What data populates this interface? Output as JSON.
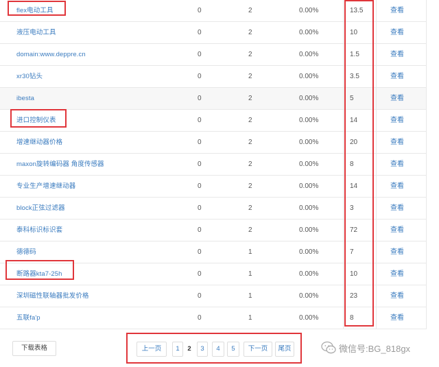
{
  "rows": [
    {
      "keyword": "flex电动工具",
      "col_a": "0",
      "col_b": "2",
      "rate": "0.00%",
      "num": "13.5",
      "action": "查看"
    },
    {
      "keyword": "液压电动工具",
      "col_a": "0",
      "col_b": "2",
      "rate": "0.00%",
      "num": "10",
      "action": "查看"
    },
    {
      "keyword": "domain:www.deppre.cn",
      "col_a": "0",
      "col_b": "2",
      "rate": "0.00%",
      "num": "1.5",
      "action": "查看"
    },
    {
      "keyword": "xr30钻头",
      "col_a": "0",
      "col_b": "2",
      "rate": "0.00%",
      "num": "3.5",
      "action": "查看"
    },
    {
      "keyword": "ibesta",
      "col_a": "0",
      "col_b": "2",
      "rate": "0.00%",
      "num": "5",
      "action": "查看"
    },
    {
      "keyword": "进口控制仪表",
      "col_a": "0",
      "col_b": "2",
      "rate": "0.00%",
      "num": "14",
      "action": "查看"
    },
    {
      "keyword": "增速继动器价格",
      "col_a": "0",
      "col_b": "2",
      "rate": "0.00%",
      "num": "20",
      "action": "查看"
    },
    {
      "keyword": "maxon旋转编码器 角度传感器",
      "col_a": "0",
      "col_b": "2",
      "rate": "0.00%",
      "num": "8",
      "action": "查看"
    },
    {
      "keyword": "专业生产增速继动器",
      "col_a": "0",
      "col_b": "2",
      "rate": "0.00%",
      "num": "14",
      "action": "查看"
    },
    {
      "keyword": "block正弦过滤器",
      "col_a": "0",
      "col_b": "2",
      "rate": "0.00%",
      "num": "3",
      "action": "查看"
    },
    {
      "keyword": "泰科标识标识套",
      "col_a": "0",
      "col_b": "2",
      "rate": "0.00%",
      "num": "72",
      "action": "查看"
    },
    {
      "keyword": "德德码",
      "col_a": "0",
      "col_b": "1",
      "rate": "0.00%",
      "num": "7",
      "action": "查看"
    },
    {
      "keyword": "断路器kta7-25h",
      "col_a": "0",
      "col_b": "1",
      "rate": "0.00%",
      "num": "10",
      "action": "查看"
    },
    {
      "keyword": "深圳磁性联轴器批发价格",
      "col_a": "0",
      "col_b": "1",
      "rate": "0.00%",
      "num": "23",
      "action": "查看"
    },
    {
      "keyword": "五联fa'p",
      "col_a": "0",
      "col_b": "1",
      "rate": "0.00%",
      "num": "8",
      "action": "查看"
    }
  ],
  "footer": {
    "export_label": "下载表格",
    "pager": {
      "prev": "上一页",
      "pages": [
        "1",
        "2",
        "3",
        "4",
        "5"
      ],
      "current": "2",
      "next": "下一页",
      "last": "尾页"
    }
  },
  "watermark": {
    "text": "微信号:BG_818gx"
  },
  "colors": {
    "link": "#3a7bbf",
    "highlight": "#e0353a",
    "alt_row": "#f7f7f7",
    "border": "#e8e8e8"
  }
}
